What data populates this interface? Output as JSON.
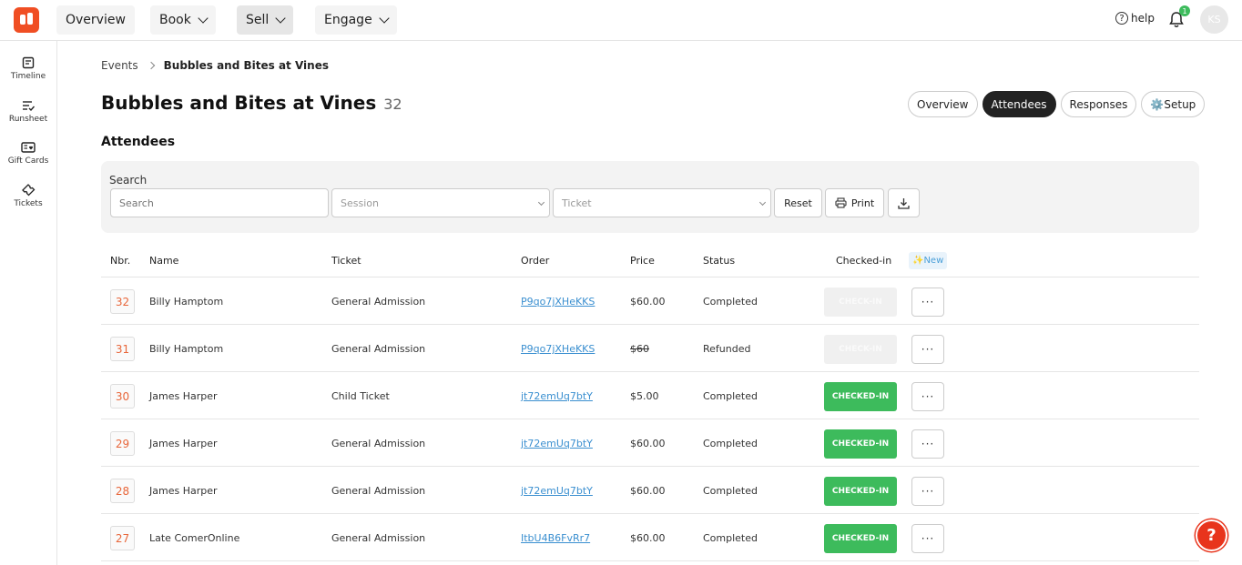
{
  "topnav": {
    "items": [
      {
        "label": "Overview",
        "dropdown": false,
        "active": false
      },
      {
        "label": "Book",
        "dropdown": true,
        "active": false
      },
      {
        "label": "Sell",
        "dropdown": true,
        "active": true
      },
      {
        "label": "Engage",
        "dropdown": true,
        "active": false
      }
    ],
    "help_label": "help",
    "notification_count": "1",
    "avatar_initials": "KS"
  },
  "sidebar": {
    "items": [
      {
        "label": "Timeline",
        "icon": "timeline-icon"
      },
      {
        "label": "Runsheet",
        "icon": "runsheet-icon"
      },
      {
        "label": "Gift Cards",
        "icon": "gift-card-icon"
      },
      {
        "label": "Tickets",
        "icon": "ticket-icon"
      }
    ]
  },
  "breadcrumb": {
    "root": "Events",
    "current": "Bubbles and Bites at Vines"
  },
  "page": {
    "title": "Bubbles and Bites at Vines",
    "count": "32",
    "section_title": "Attendees"
  },
  "tabs": [
    {
      "label": "Overview",
      "active": false
    },
    {
      "label": "Attendees",
      "active": true
    },
    {
      "label": "Responses",
      "active": false
    },
    {
      "label": "⚙️Setup",
      "active": false
    }
  ],
  "filters": {
    "search_label": "Search",
    "search_placeholder": "Search",
    "session_placeholder": "Session",
    "ticket_placeholder": "Ticket",
    "reset_label": "Reset",
    "print_label": "Print"
  },
  "table": {
    "headers": {
      "nbr": "Nbr.",
      "name": "Name",
      "ticket": "Ticket",
      "order": "Order",
      "price": "Price",
      "status": "Status",
      "checked_in": "Checked-in",
      "new_badge": "✨New"
    },
    "rows": [
      {
        "nbr": "32",
        "name": "Billy Hamptom",
        "ticket": "General Admission",
        "order": "P9qo7jXHeKKS",
        "price": "$60.00",
        "price_struck": false,
        "status": "Completed",
        "checkin_label": "CHECK-IN",
        "checked_in": false,
        "checkin_disabled": true
      },
      {
        "nbr": "31",
        "name": "Billy Hamptom",
        "ticket": "General Admission",
        "order": "P9qo7jXHeKKS",
        "price": "$60",
        "price_struck": true,
        "status": "Refunded",
        "checkin_label": "CHECK-IN",
        "checked_in": false,
        "checkin_disabled": true
      },
      {
        "nbr": "30",
        "name": "James Harper",
        "ticket": "Child Ticket",
        "order": "jt72emUq7btY",
        "price": "$5.00",
        "price_struck": false,
        "status": "Completed",
        "checkin_label": "CHECKED-IN",
        "checked_in": true,
        "checkin_disabled": false
      },
      {
        "nbr": "29",
        "name": "James Harper",
        "ticket": "General Admission",
        "order": "jt72emUq7btY",
        "price": "$60.00",
        "price_struck": false,
        "status": "Completed",
        "checkin_label": "CHECKED-IN",
        "checked_in": true,
        "checkin_disabled": false
      },
      {
        "nbr": "28",
        "name": "James Harper",
        "ticket": "General Admission",
        "order": "jt72emUq7btY",
        "price": "$60.00",
        "price_struck": false,
        "status": "Completed",
        "checkin_label": "CHECKED-IN",
        "checked_in": true,
        "checkin_disabled": false
      },
      {
        "nbr": "27",
        "name": "Late ComerOnline",
        "ticket": "General Admission",
        "order": "ItbU4B6FvRr7",
        "price": "$60.00",
        "price_struck": false,
        "status": "Completed",
        "checkin_label": "CHECKED-IN",
        "checked_in": true,
        "checkin_disabled": false
      }
    ],
    "more_label": "···"
  },
  "help_fab": "?",
  "colors": {
    "brand": "#f04e23",
    "checked_in": "#3dbb5c",
    "link": "#3a8fd0",
    "number": "#e8663a"
  }
}
